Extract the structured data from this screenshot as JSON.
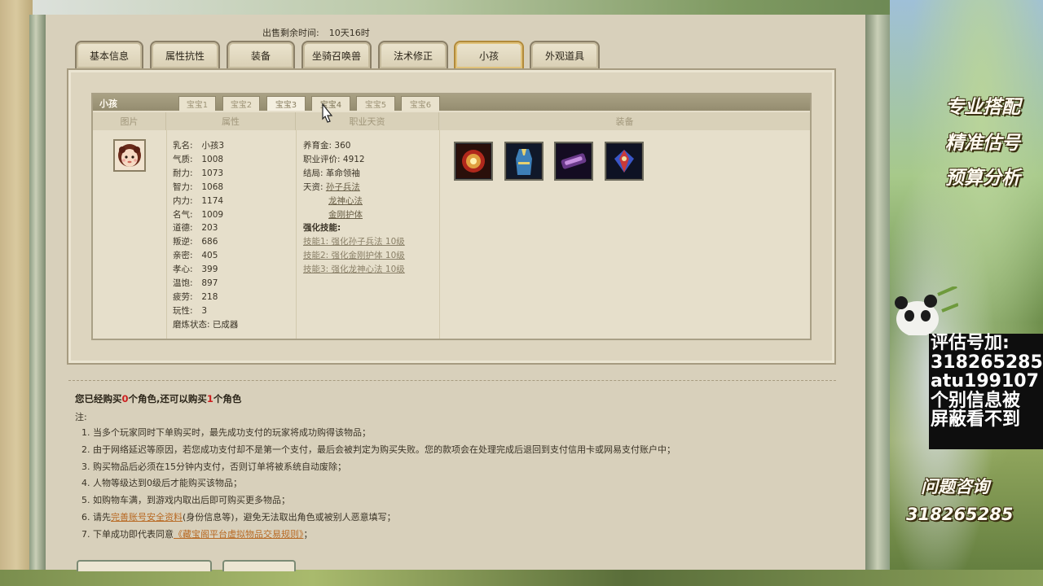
{
  "header": {
    "remaining_label": "出售剩余时间:",
    "remaining_value": "10天16时"
  },
  "tabs": [
    "基本信息",
    "属性抗性",
    "装备",
    "坐骑召唤兽",
    "法术修正",
    "小孩",
    "外观道具"
  ],
  "active_tab": "小孩",
  "child_panel": {
    "label": "小孩",
    "subtabs": [
      "宝宝1",
      "宝宝2",
      "宝宝3",
      "宝宝4",
      "宝宝5",
      "宝宝6"
    ],
    "active_subtab": "宝宝3",
    "columns": [
      "图片",
      "属性",
      "职业天资",
      "装备"
    ]
  },
  "attributes": [
    {
      "k": "乳名:",
      "v": "小孩3"
    },
    {
      "k": "气质:",
      "v": "1008"
    },
    {
      "k": "耐力:",
      "v": "1073"
    },
    {
      "k": "智力:",
      "v": "1068"
    },
    {
      "k": "内力:",
      "v": "1174"
    },
    {
      "k": "名气:",
      "v": "1009"
    },
    {
      "k": "道德:",
      "v": "203"
    },
    {
      "k": "叛逆:",
      "v": "686"
    },
    {
      "k": "亲密:",
      "v": "405"
    },
    {
      "k": "孝心:",
      "v": "399"
    },
    {
      "k": "温饱:",
      "v": "897"
    },
    {
      "k": "疲劳:",
      "v": "218"
    },
    {
      "k": "玩性:",
      "v": "3"
    },
    {
      "k": "磨炼状态:",
      "v": "已成器"
    }
  ],
  "talent": {
    "fund_label": "养育金:",
    "fund": "360",
    "rating_label": "职业评价:",
    "rating": "4912",
    "ending_label": "结局:",
    "ending": "革命领袖",
    "gift_label": "天资:",
    "gifts": [
      "孙子兵法",
      "龙神心法",
      "金刚护体"
    ],
    "skills_label": "强化技能:",
    "skills": [
      "技能1: 强化孙子兵法 10级",
      "技能2: 强化金刚护体 10级",
      "技能3: 强化龙神心法 10级"
    ]
  },
  "equipment_icons": [
    "orb-item-icon",
    "robe-item-icon",
    "scroll-item-icon",
    "gem-item-icon"
  ],
  "notes": {
    "bought_prefix": "您已经购买",
    "bought_count": "0",
    "bought_mid": "个角色,还可以购买",
    "remain_count": "1",
    "bought_suffix": "个角色",
    "title": "注:",
    "items": [
      "1. 当多个玩家同时下单购买时，最先成功支付的玩家将成功购得该物品；",
      "2. 由于网络延迟等原因，若您成功支付却不是第一个支付，最后会被判定为购买失败。您的款项会在处理完成后退回到支付信用卡或网易支付账户中；",
      "3. 购买物品后必须在15分钟内支付，否则订单将被系统自动废除；",
      "4. 人物等级达到0级后才能购买该物品；",
      "5. 如购物车满，到游戏内取出后即可购买更多物品；"
    ],
    "item6_prefix": "6. 请先",
    "item6_link": "完善账号安全资料",
    "item6_suffix": "(身份信息等)，避免无法取出角色或被别人恶意填写；",
    "item7_prefix": "7. 下单成功即代表同意",
    "item7_link": "《藏宝阁平台虚拟物品交易规则》",
    "item7_suffix": "；"
  },
  "promo": {
    "lines": [
      "专业搭配",
      "精准估号",
      "预算分析"
    ],
    "eval_lines": [
      "评估号加:",
      "318265285",
      "atu199107",
      "个别信息被",
      "屏蔽看不到"
    ],
    "consult_label": "问题咨询",
    "consult_number": "318265285"
  }
}
